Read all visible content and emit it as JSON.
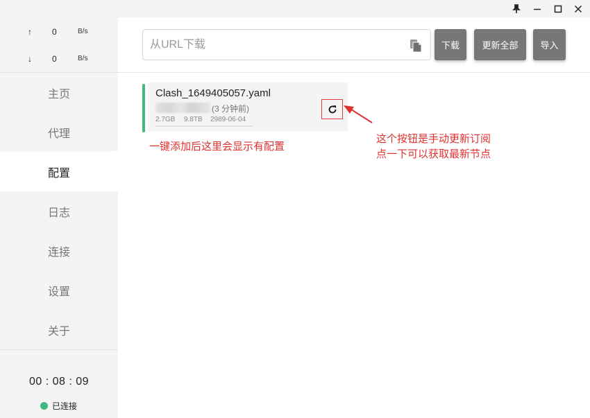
{
  "window": {
    "pin_icon": "pin-icon",
    "minimize_icon": "minimize-icon",
    "maximize_icon": "maximize-icon",
    "close_icon": "close-icon"
  },
  "traffic": {
    "up_arrow": "↑",
    "up_value": "0",
    "up_unit": "B/s",
    "down_arrow": "↓",
    "down_value": "0",
    "down_unit": "B/s"
  },
  "nav": {
    "items": [
      {
        "label": "主页"
      },
      {
        "label": "代理"
      },
      {
        "label": "配置"
      },
      {
        "label": "日志"
      },
      {
        "label": "连接"
      },
      {
        "label": "设置"
      },
      {
        "label": "关于"
      }
    ],
    "active": "配置"
  },
  "footer": {
    "timer": "00 : 08 : 09",
    "status": "已连接",
    "status_color": "#3fb97d"
  },
  "toolbar": {
    "url_placeholder": "从URL下载",
    "url_value": "",
    "paste_icon": "paste-icon",
    "download_label": "下载",
    "update_all_label": "更新全部",
    "import_label": "导入",
    "button_color": "#777777"
  },
  "profile": {
    "name": "Clash_1649405057.yaml",
    "updated": "(3 分钟前)",
    "used": "2.7GB",
    "total": "9.8TB",
    "expire": "2989-06-04",
    "accent_color": "#3fb97d",
    "refresh_icon": "refresh-icon"
  },
  "annotations": {
    "left_note": "一键添加后这里会显示有配置",
    "right_note_line1": "这个按钮是手动更新订阅",
    "right_note_line2": "点一下可以获取最新节点",
    "color": "#e03131"
  }
}
